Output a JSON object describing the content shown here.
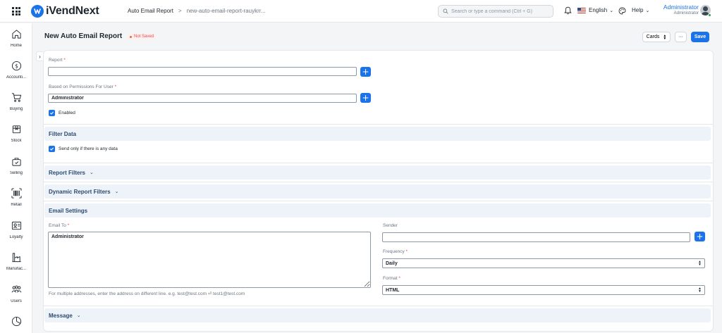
{
  "navbar": {
    "brand": "iVendNext",
    "brand_logo_letter": "iV",
    "breadcrumb_1": "Auto Email Report",
    "breadcrumb_sep": ">",
    "breadcrumb_2": "new-auto-email-report-rauykrr...",
    "search_placeholder": "Search or type a command (Ctrl + G)",
    "language": "English",
    "help": "Help",
    "user_name": "Administrator",
    "user_role": "Administrator"
  },
  "sidebar": {
    "items": [
      {
        "label": "Home",
        "icon": "home-icon"
      },
      {
        "label": "Accounti...",
        "icon": "dollar-icon"
      },
      {
        "label": "Buying",
        "icon": "cart-icon"
      },
      {
        "label": "Stock",
        "icon": "box-icon"
      },
      {
        "label": "Selling",
        "icon": "selling-icon"
      },
      {
        "label": "Retail",
        "icon": "barcode-icon"
      },
      {
        "label": "Loyalty",
        "icon": "loyalty-card-icon"
      },
      {
        "label": "Manufac...",
        "icon": "factory-icon"
      },
      {
        "label": "Users",
        "icon": "users-icon"
      },
      {
        "label": "",
        "icon": "chart-pie-icon"
      }
    ]
  },
  "page": {
    "title": "New Auto Email Report",
    "status": "Not Saved",
    "cards_label": "Cards",
    "more_label": "···",
    "save_label": "Save"
  },
  "form": {
    "report_label": "Report",
    "report_value": "",
    "permissions_label": "Based on Permissions For User",
    "permissions_value": "Administrator",
    "enabled_label": "Enabled",
    "required_mark": "*"
  },
  "sections": {
    "filter_data": "Filter Data",
    "send_only_label": "Send only if there is any data",
    "report_filters": "Report Filters",
    "dynamic_report_filters": "Dynamic Report Filters",
    "email_settings": "Email Settings",
    "message": "Message"
  },
  "email": {
    "email_to_label": "Email To",
    "email_to_value": "Administrator",
    "email_help": "For multiple addresses, enter the address on different line. e.g. test@test.com ⏎ test1@test.com",
    "sender_label": "Sender",
    "sender_value": "",
    "frequency_label": "Frequency",
    "frequency_value": "Daily",
    "format_label": "Format",
    "format_value": "HTML"
  },
  "colors": {
    "primary": "#1a73e8",
    "not_saved": "#e24c4c",
    "section_bg": "#eef3fa"
  }
}
